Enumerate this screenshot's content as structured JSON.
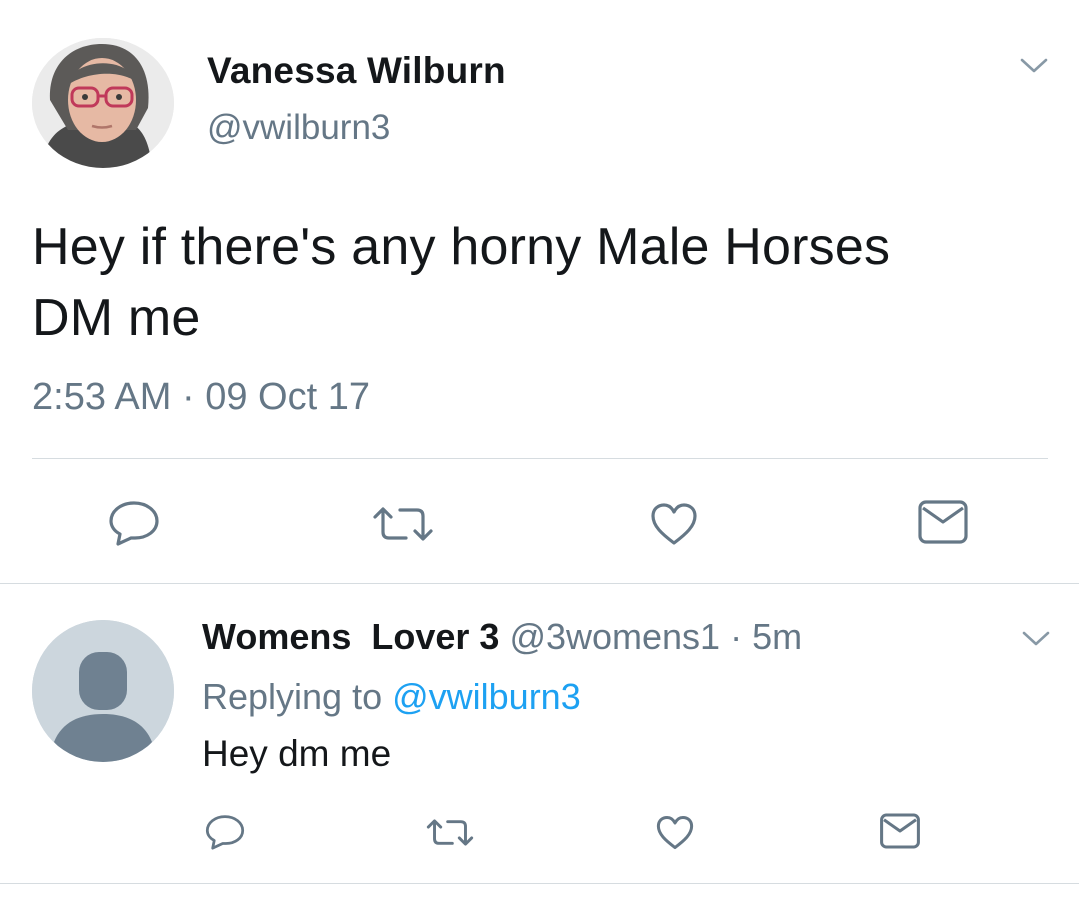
{
  "main_tweet": {
    "author_name": "Vanessa Wilburn",
    "author_handle": "@vwilburn3",
    "text_line1": "Hey if there's any horny Male Horses",
    "text_line2": "DM me",
    "timestamp": "2:53 AM · 09 Oct 17",
    "avatar": "profile-photo",
    "actions": [
      "reply-icon",
      "retweet-icon",
      "like-icon",
      "message-icon"
    ]
  },
  "reply_tweet": {
    "author_name": "Womens  Lover 3",
    "author_handle": "@3womens1",
    "separator": "·",
    "time": "5m",
    "replying_prefix": "Replying to ",
    "replying_handle": "@vwilburn3",
    "text": "Hey dm me",
    "avatar": "default-egg-avatar",
    "actions": [
      "reply-icon",
      "retweet-icon",
      "like-icon",
      "message-icon"
    ]
  },
  "colors": {
    "text_primary": "#14171a",
    "text_secondary": "#657786",
    "link": "#1da1f2",
    "icon": "#657786",
    "divider": "#d6dce0",
    "default_avatar_bg": "#ccd6dd"
  }
}
